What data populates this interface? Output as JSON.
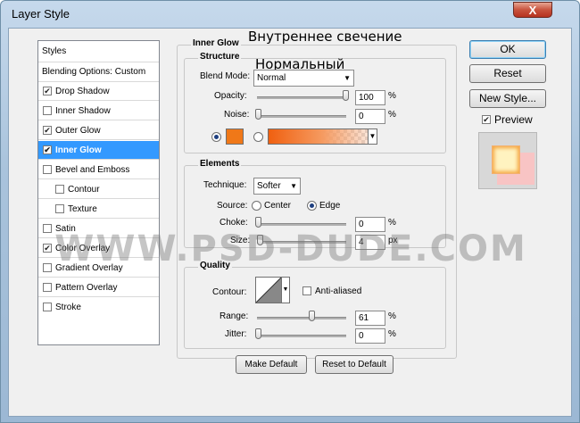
{
  "window": {
    "title": "Layer Style",
    "close_glyph": "X"
  },
  "sidebar": {
    "styles_header": "Styles",
    "blending_header": "Blending Options: Custom",
    "items": [
      {
        "label": "Drop Shadow",
        "checked": true
      },
      {
        "label": "Inner Shadow",
        "checked": false
      },
      {
        "label": "Outer Glow",
        "checked": true
      },
      {
        "label": "Inner Glow",
        "checked": true,
        "selected": true
      },
      {
        "label": "Bevel and Emboss",
        "checked": false
      },
      {
        "label": "Contour",
        "checked": false,
        "indent": true
      },
      {
        "label": "Texture",
        "checked": false,
        "indent": true
      },
      {
        "label": "Satin",
        "checked": false
      },
      {
        "label": "Color Overlay",
        "checked": true
      },
      {
        "label": "Gradient Overlay",
        "checked": false
      },
      {
        "label": "Pattern Overlay",
        "checked": false
      },
      {
        "label": "Stroke",
        "checked": false
      }
    ],
    "check_glyph": "✔"
  },
  "panel": {
    "title": "Inner Glow",
    "annotation_title": "Внутреннее свечение",
    "annotation_mode": "Нормальный",
    "structure": {
      "label": "Structure",
      "blend_mode_label": "Blend Mode:",
      "blend_mode_value": "Normal",
      "opacity_label": "Opacity:",
      "opacity_value": "100",
      "noise_label": "Noise:",
      "noise_value": "0",
      "percent": "%",
      "opacity_fraction": 1.0,
      "noise_fraction": 0.0,
      "glow_color": "#f07818"
    },
    "elements": {
      "label": "Elements",
      "technique_label": "Technique:",
      "technique_value": "Softer",
      "source_label": "Source:",
      "source_center": "Center",
      "source_edge": "Edge",
      "choke_label": "Choke:",
      "choke_value": "0",
      "size_label": "Size:",
      "size_value": "4",
      "percent": "%",
      "px": "px"
    },
    "quality": {
      "label": "Quality",
      "contour_label": "Contour:",
      "anti_aliased_label": "Anti-aliased",
      "range_label": "Range:",
      "range_value": "61",
      "jitter_label": "Jitter:",
      "jitter_value": "0",
      "percent": "%",
      "range_fraction": 0.61,
      "jitter_fraction": 0.0
    },
    "make_default": "Make Default",
    "reset_to_default": "Reset to Default"
  },
  "buttons": {
    "ok": "OK",
    "reset": "Reset",
    "new_style": "New Style...",
    "preview_label": "Preview",
    "preview_checked": true
  },
  "watermark": "WWW.PSD-DUDE.COM",
  "colors": {
    "accent_selected": "#3399ff",
    "preview_fill": "#fff3c0",
    "preview_glow": "#f5a641",
    "preview_shadow": "#f8c4c4"
  }
}
